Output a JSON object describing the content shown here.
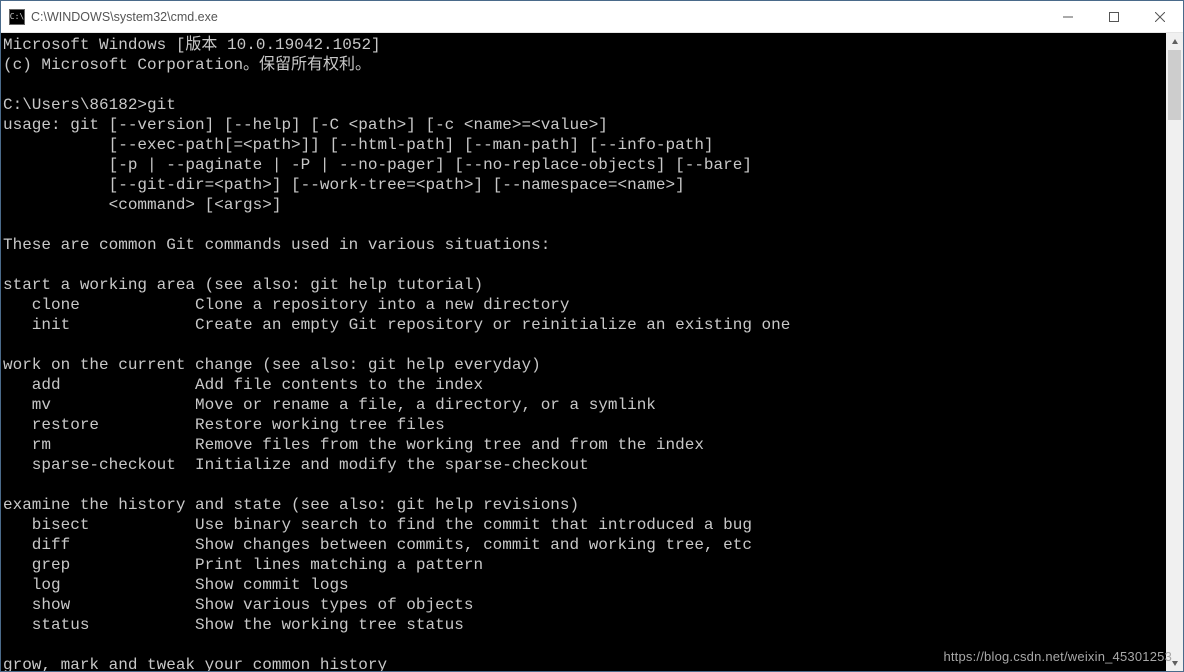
{
  "window": {
    "title": "C:\\WINDOWS\\system32\\cmd.exe"
  },
  "watermark": "https://blog.csdn.net/weixin_45301253",
  "terminal": {
    "banner": [
      "Microsoft Windows [版本 10.0.19042.1052]",
      "(c) Microsoft Corporation。保留所有权利。"
    ],
    "prompt": "C:\\Users\\86182>",
    "command": "git",
    "usage": [
      "usage: git [--version] [--help] [-C <path>] [-c <name>=<value>]",
      "           [--exec-path[=<path>]] [--html-path] [--man-path] [--info-path]",
      "           [-p | --paginate | -P | --no-pager] [--no-replace-objects] [--bare]",
      "           [--git-dir=<path>] [--work-tree=<path>] [--namespace=<name>]",
      "           <command> [<args>]"
    ],
    "common_intro": "These are common Git commands used in various situations:",
    "sections": [
      {
        "heading": "start a working area (see also: git help tutorial)",
        "items": [
          {
            "cmd": "clone",
            "desc": "Clone a repository into a new directory"
          },
          {
            "cmd": "init",
            "desc": "Create an empty Git repository or reinitialize an existing one"
          }
        ]
      },
      {
        "heading": "work on the current change (see also: git help everyday)",
        "items": [
          {
            "cmd": "add",
            "desc": "Add file contents to the index"
          },
          {
            "cmd": "mv",
            "desc": "Move or rename a file, a directory, or a symlink"
          },
          {
            "cmd": "restore",
            "desc": "Restore working tree files"
          },
          {
            "cmd": "rm",
            "desc": "Remove files from the working tree and from the index"
          },
          {
            "cmd": "sparse-checkout",
            "desc": "Initialize and modify the sparse-checkout"
          }
        ]
      },
      {
        "heading": "examine the history and state (see also: git help revisions)",
        "items": [
          {
            "cmd": "bisect",
            "desc": "Use binary search to find the commit that introduced a bug"
          },
          {
            "cmd": "diff",
            "desc": "Show changes between commits, commit and working tree, etc"
          },
          {
            "cmd": "grep",
            "desc": "Print lines matching a pattern"
          },
          {
            "cmd": "log",
            "desc": "Show commit logs"
          },
          {
            "cmd": "show",
            "desc": "Show various types of objects"
          },
          {
            "cmd": "status",
            "desc": "Show the working tree status"
          }
        ]
      }
    ],
    "trailing": "grow, mark and tweak your common history"
  }
}
